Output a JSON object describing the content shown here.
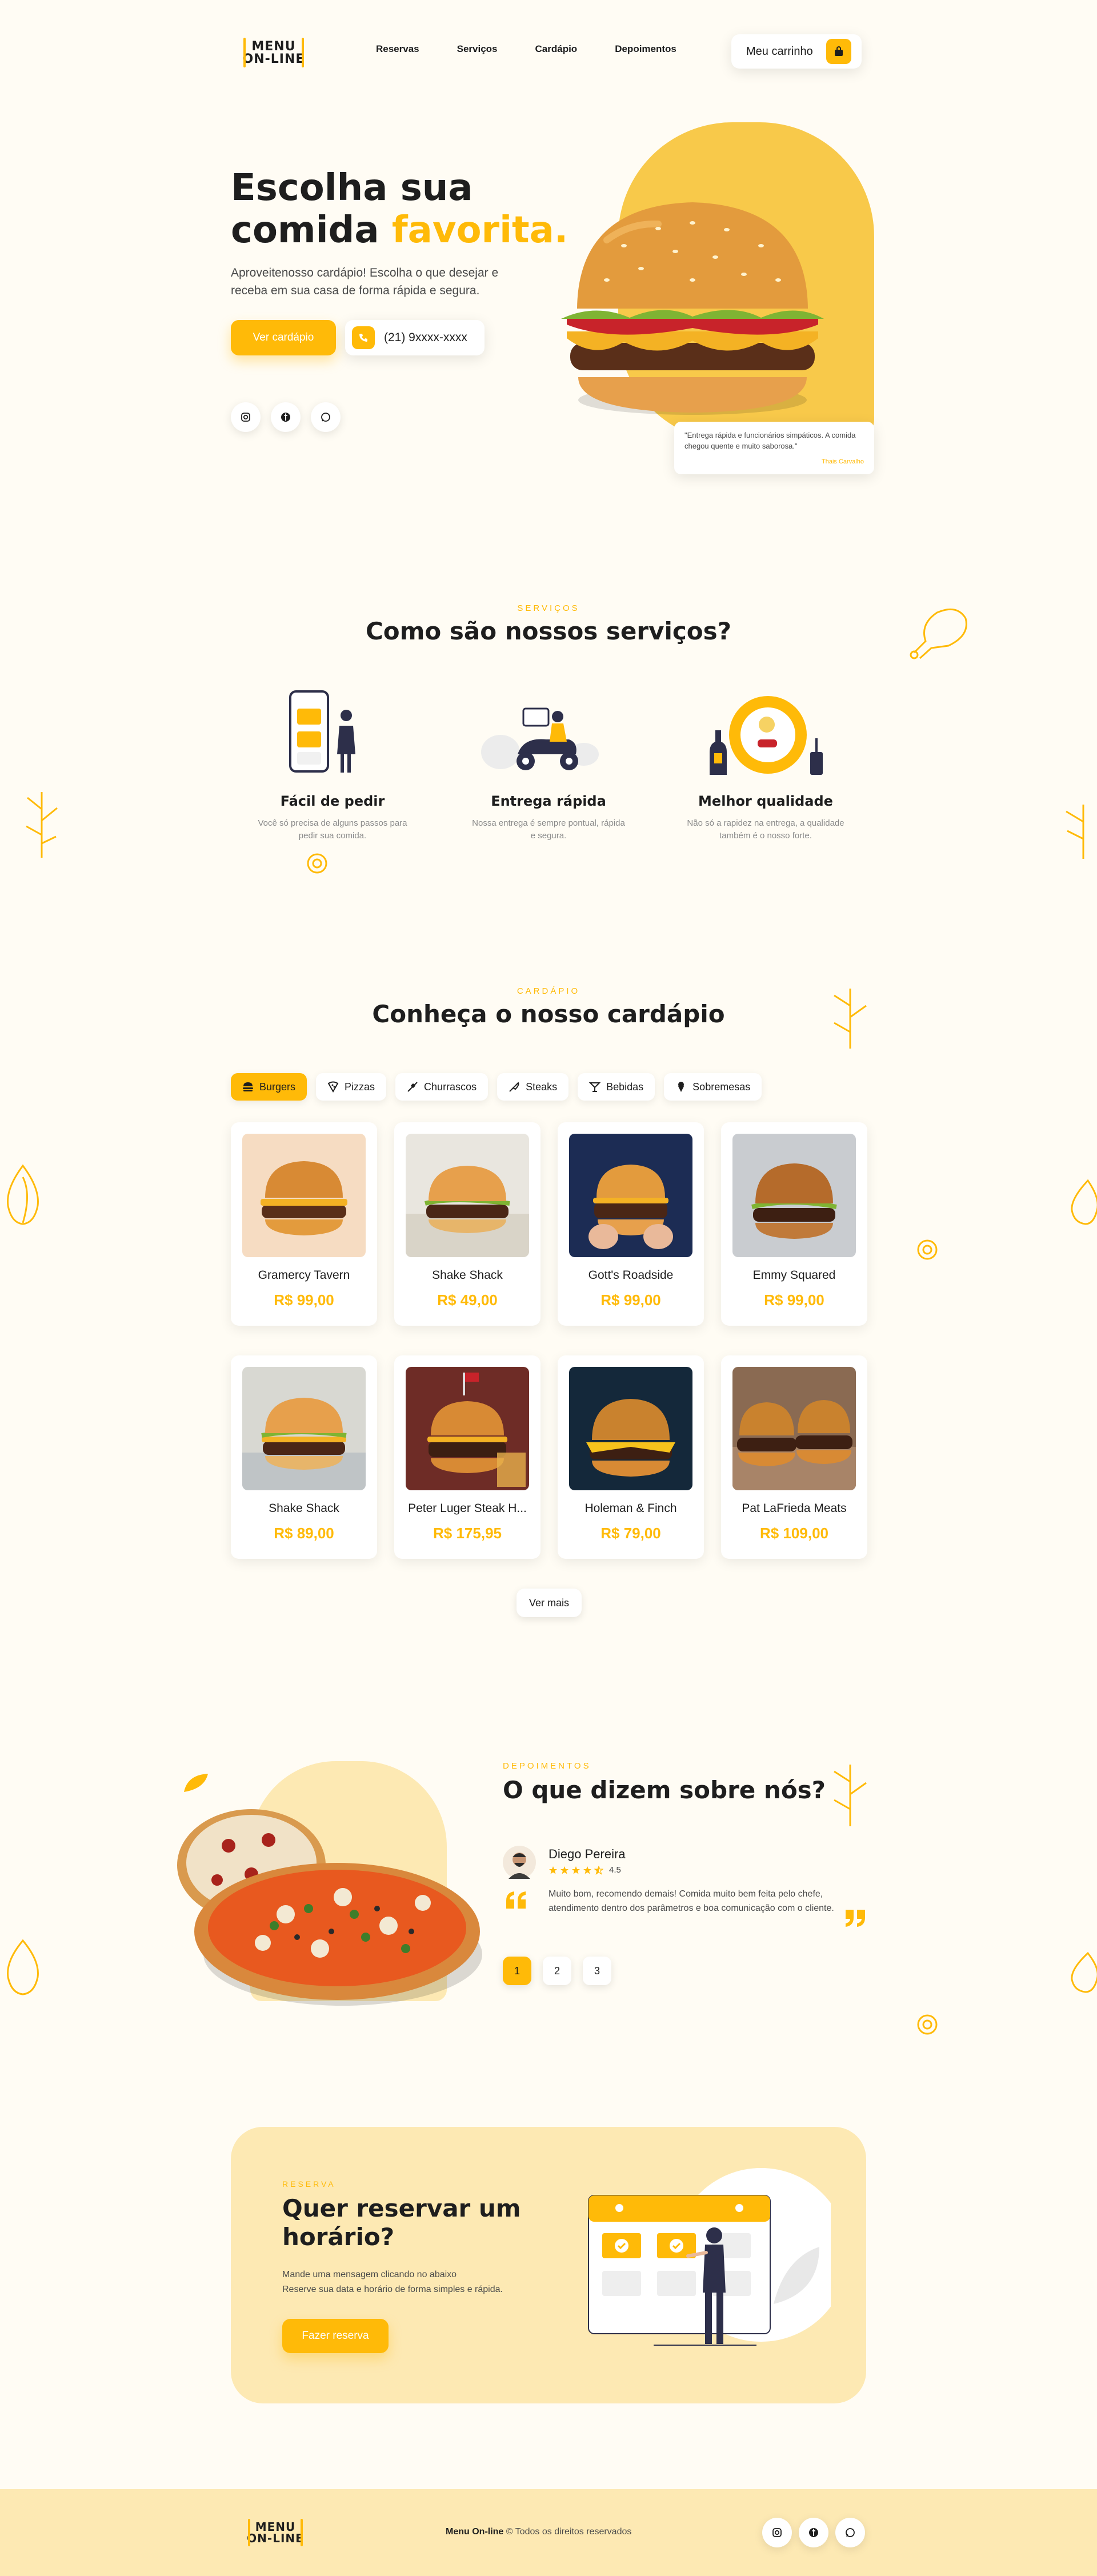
{
  "brand": {
    "line1": "MENU",
    "line2": "ON-LINE"
  },
  "nav": {
    "items": [
      "Reservas",
      "Serviços",
      "Cardápio",
      "Depoimentos"
    ]
  },
  "cart": {
    "label": "Meu carrinho",
    "icon": "bag-icon"
  },
  "hero": {
    "title_line1": "Escolha sua",
    "title_line2_a": "comida ",
    "title_line2_b": "favorita.",
    "subtitle": "Aproveitenosso cardápio! Escolha o que desejar e receba em sua casa de forma rápida e segura.",
    "cta": "Ver cardápio",
    "phone": "(21) 9xxxx-xxxx",
    "quote": "\"Entrega rápida e funcionários simpáticos. A comida chegou quente e muito saborosa.\"",
    "quote_author": "Thais Carvalho"
  },
  "social": [
    "instagram-icon",
    "facebook-icon",
    "whatsapp-icon"
  ],
  "services": {
    "eyebrow": "SERVIÇOS",
    "title": "Como são nossos serviços?",
    "items": [
      {
        "title": "Fácil de pedir",
        "text": "Você só precisa de alguns passos para pedir sua comida."
      },
      {
        "title": "Entrega rápida",
        "text": "Nossa entrega é sempre pontual, rápida e segura."
      },
      {
        "title": "Melhor qualidade",
        "text": "Não só a rapidez na entrega, a qualidade também é o nosso forte."
      }
    ]
  },
  "menu": {
    "eyebrow": "CARDÁPIO",
    "title": "Conheça o nosso cardápio",
    "tabs": [
      "Burgers",
      "Pizzas",
      "Churrascos",
      "Steaks",
      "Bebidas",
      "Sobremesas"
    ],
    "items": [
      {
        "name": "Gramercy Tavern",
        "price": "R$ 99,00"
      },
      {
        "name": "Shake Shack",
        "price": "R$ 49,00"
      },
      {
        "name": "Gott's Roadside",
        "price": "R$ 99,00"
      },
      {
        "name": "Emmy Squared",
        "price": "R$ 99,00"
      },
      {
        "name": "Shake Shack",
        "price": "R$ 89,00"
      },
      {
        "name": "Peter Luger Steak H...",
        "price": "R$ 175,95"
      },
      {
        "name": "Holeman & Finch",
        "price": "R$ 79,00"
      },
      {
        "name": "Pat LaFrieda Meats",
        "price": "R$ 109,00"
      }
    ],
    "more": "Ver mais"
  },
  "testimonials": {
    "eyebrow": "DEPOIMENTOS",
    "title": "O que dizem sobre nós?",
    "name": "Diego Pereira",
    "rating": "4.5",
    "rating_value": 4.5,
    "text": "Muito bom, recomendo demais! Comida muito bem feita pelo chefe, atendimento dentro dos parâmetros e boa comunicação com o cliente.",
    "pages": [
      "1",
      "2",
      "3"
    ]
  },
  "reservation": {
    "eyebrow": "RESERVA",
    "title_line1": "Quer reservar um",
    "title_line2": "horário?",
    "text_line1": "Mande uma mensagem clicando no abaixo",
    "text_line2": "Reserve sua data e horário de forma simples e rápida.",
    "cta": "Fazer reserva"
  },
  "footer": {
    "brand": "Menu On-line",
    "rights": " © Todos os direitos reservados"
  },
  "colors": {
    "accent": "#ffba08",
    "background": "#fffcf4",
    "soft": "#fde9b3"
  }
}
